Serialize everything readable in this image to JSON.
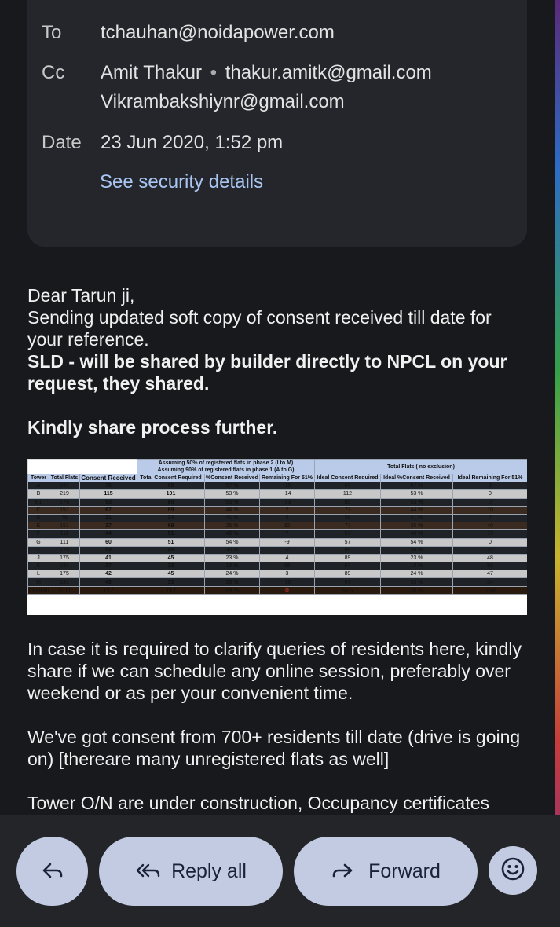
{
  "header": {
    "to_label": "To",
    "to_value": "tchauhan@noidapower.com",
    "cc_label": "Cc",
    "cc_name": "Amit Thakur",
    "cc_sep": "•",
    "cc_email1": "thakur.amitk@gmail.com",
    "cc_email2": "Vikrambakshiynr@gmail.com",
    "date_label": "Date",
    "date_value": "23 Jun 2020, 1:52 pm",
    "security_link": "See security details"
  },
  "body": {
    "greeting": "Dear Tarun ji,",
    "line1": "Sending updated soft copy of consent received till date for your reference.",
    "bold1": "SLD - will be shared by builder directly to NPCL on your request, they shared.",
    "bold2": "Kindly share process further.",
    "para2": "In case it is required to clarify queries of residents here, kindly share if we can schedule any online session, preferably over weekend or as per your convenient time.",
    "para3": "We've got consent from 700+ residents till date (drive is going on) [thereare many unregistered flats as well]",
    "para4": "Tower O/N are under construction, Occupancy certificates"
  },
  "table": {
    "header_group1_line1": "Assuming 50% of registered flats in phase 2 (I to M)",
    "header_group1_line2": "Assuming 90% of registered flats in phase 1 (A to G)",
    "header_group2": "Total Flats ( no exclusion)",
    "columns": [
      "Tower",
      "Total Flats",
      "Consent Received",
      "Total Consent Required",
      "%Consent Received",
      "Remaining For 51%",
      "Ideal Consent Required",
      "Ideal %Consent Received",
      "Ideal Remaining For 51%"
    ],
    "rows": [
      {
        "style": "dark",
        "cells": [
          "A",
          "131",
          "75",
          "60",
          "57 %",
          "-15",
          "67",
          "57 %",
          "0"
        ]
      },
      {
        "style": "grey",
        "cells": [
          "B",
          "219",
          "115",
          "101",
          "53 %",
          "-14",
          "112",
          "53 %",
          "0"
        ]
      },
      {
        "style": "dark",
        "cells": [
          "B1",
          "175",
          "93",
          "80",
          "53 %",
          "-13",
          "89",
          "53 %",
          "0"
        ]
      },
      {
        "style": "brown",
        "cells": [
          "C",
          "151",
          "67",
          "69",
          "44 %",
          "2",
          "77",
          "44 %",
          "10"
        ]
      },
      {
        "style": "dark",
        "cells": [
          "D",
          "75",
          "31",
          "34",
          "41 %",
          "3",
          "38",
          "41 %",
          "7"
        ]
      },
      {
        "style": "brown",
        "cells": [
          "E",
          "151",
          "37",
          "69",
          "25 %",
          "32",
          "77",
          "25 %",
          "40"
        ]
      },
      {
        "style": "dark",
        "cells": [
          "F",
          "111",
          "44",
          "51",
          "40 %",
          "7",
          "57",
          "40 %",
          "13"
        ]
      },
      {
        "style": "grey",
        "cells": [
          "G",
          "111",
          "60",
          "51",
          "54 %",
          "-9",
          "57",
          "54 %",
          "0"
        ]
      },
      {
        "style": "dark",
        "cells": [
          "I",
          "175",
          "52",
          "45",
          "30 %",
          "-7",
          "89",
          "30 %",
          "37"
        ]
      },
      {
        "style": "grey",
        "cells": [
          "J",
          "175",
          "41",
          "45",
          "23 %",
          "4",
          "89",
          "23 %",
          "48"
        ]
      },
      {
        "style": "dark",
        "cells": [
          "K",
          "131",
          "17",
          "33",
          "13 %",
          "16",
          "67",
          "13 %",
          "50"
        ]
      },
      {
        "style": "grey",
        "cells": [
          "L",
          "175",
          "42",
          "45",
          "24 %",
          "3",
          "89",
          "24 %",
          "47"
        ]
      },
      {
        "style": "dark",
        "cells": [
          "M",
          "131",
          "43",
          "33",
          "33 %",
          "-10",
          "67",
          "33 %",
          "24"
        ]
      },
      {
        "style": "overall",
        "cells": [
          "Overall",
          "1911",
          "717",
          "717",
          "38 %",
          "0",
          "975",
          "38 %",
          "258"
        ]
      }
    ]
  },
  "actions": {
    "reply_all": "Reply all",
    "forward": "Forward"
  }
}
